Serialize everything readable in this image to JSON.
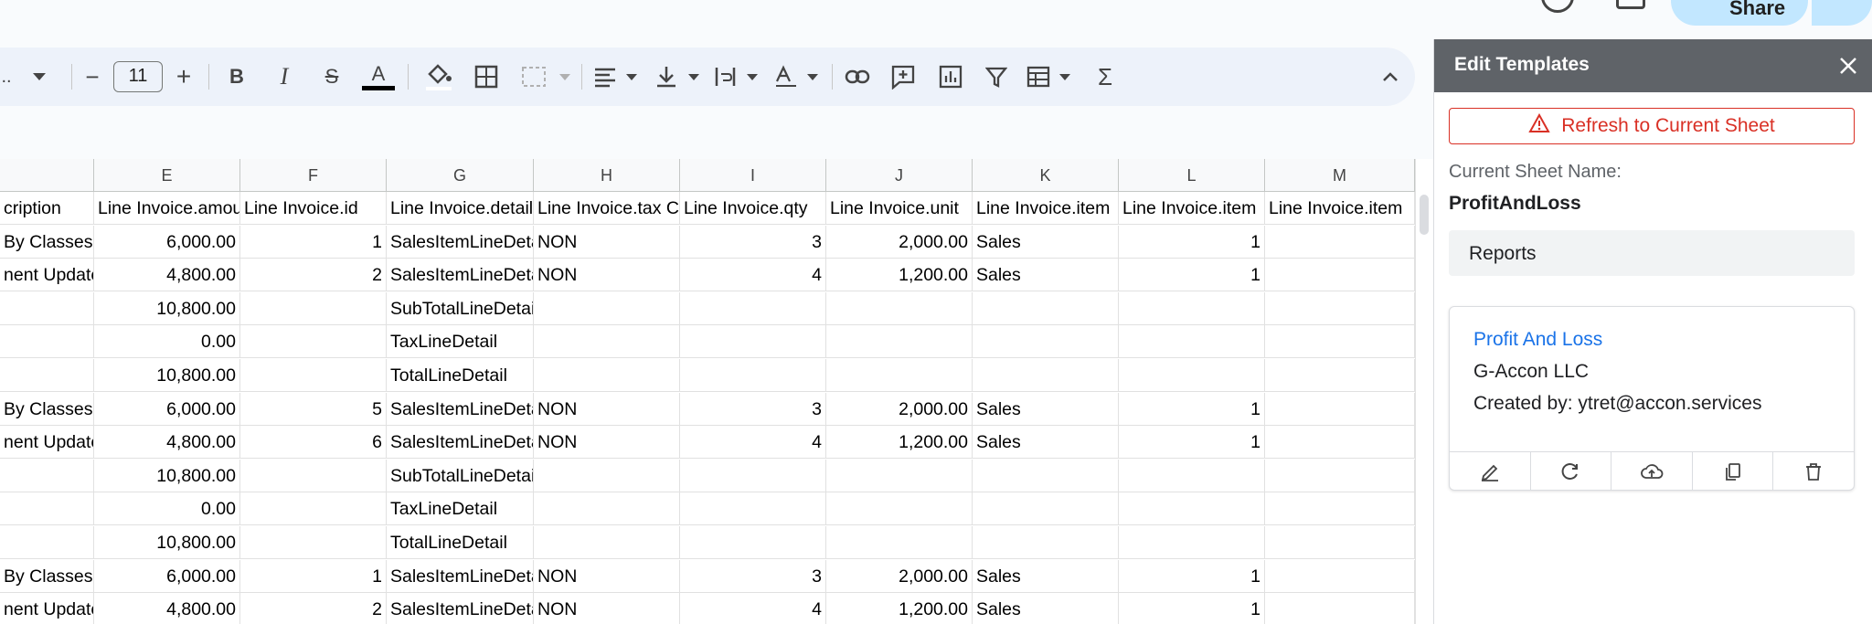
{
  "toolbar": {
    "font_name_ellipsis": "..",
    "font_size": "11",
    "minus": "−",
    "plus": "+",
    "bold": "B",
    "italic": "I",
    "strike": "S",
    "text_color_letter": "A",
    "sum": "Σ"
  },
  "share": {
    "label": "Share"
  },
  "grid": {
    "columns": [
      "E",
      "F",
      "G",
      "H",
      "I",
      "J",
      "K",
      "L",
      "M"
    ],
    "header_row": [
      "cription",
      "Line Invoice.amount",
      "Line Invoice.id",
      "Line Invoice.detail",
      "Line Invoice.tax C",
      "Line Invoice.qty",
      "Line Invoice.unit",
      "Line Invoice.item",
      "Line Invoice.item",
      "Line Invoice.item"
    ],
    "rows": [
      [
        " By Classes",
        "6,000.00",
        "1",
        "SalesItemLineDetail",
        "NON",
        "3",
        "2,000.00",
        "Sales",
        "1",
        ""
      ],
      [
        "nent Update",
        "4,800.00",
        "2",
        "SalesItemLineDetail",
        "NON",
        "4",
        "1,200.00",
        "Sales",
        "1",
        ""
      ],
      [
        "",
        "10,800.00",
        "",
        "SubTotalLineDetail",
        "",
        "",
        "",
        "",
        "",
        ""
      ],
      [
        "",
        "0.00",
        "",
        "TaxLineDetail",
        "",
        "",
        "",
        "",
        "",
        ""
      ],
      [
        "",
        "10,800.00",
        "",
        "TotalLineDetail",
        "",
        "",
        "",
        "",
        "",
        ""
      ],
      [
        " By Classes",
        "6,000.00",
        "5",
        "SalesItemLineDetail",
        "NON",
        "3",
        "2,000.00",
        "Sales",
        "1",
        ""
      ],
      [
        "nent Update",
        "4,800.00",
        "6",
        "SalesItemLineDetail",
        "NON",
        "4",
        "1,200.00",
        "Sales",
        "1",
        ""
      ],
      [
        "",
        "10,800.00",
        "",
        "SubTotalLineDetail",
        "",
        "",
        "",
        "",
        "",
        ""
      ],
      [
        "",
        "0.00",
        "",
        "TaxLineDetail",
        "",
        "",
        "",
        "",
        "",
        ""
      ],
      [
        "",
        "10,800.00",
        "",
        "TotalLineDetail",
        "",
        "",
        "",
        "",
        "",
        ""
      ],
      [
        " By Classes",
        "6,000.00",
        "1",
        "SalesItemLineDetail",
        "NON",
        "3",
        "2,000.00",
        "Sales",
        "1",
        ""
      ],
      [
        "nent Update",
        "4,800.00",
        "2",
        "SalesItemLineDetail",
        "NON",
        "4",
        "1,200.00",
        "Sales",
        "1",
        ""
      ]
    ]
  },
  "panel": {
    "title": "Edit Templates",
    "refresh_label": "Refresh to Current Sheet",
    "sheet_name_label": "Current Sheet Name:",
    "sheet_name_value": "ProfitAndLoss",
    "section_label": "Reports",
    "card": {
      "title": "Profit And Loss",
      "company": "G-Accon LLC",
      "created_by": "Created by: ytret@accon.services"
    }
  },
  "colors": {
    "accent_blue": "#1a73e8",
    "danger_red": "#d93025",
    "panel_header": "#5f6368",
    "toolbar_bg": "#edf2fa",
    "share_bg": "#c2e7ff"
  }
}
